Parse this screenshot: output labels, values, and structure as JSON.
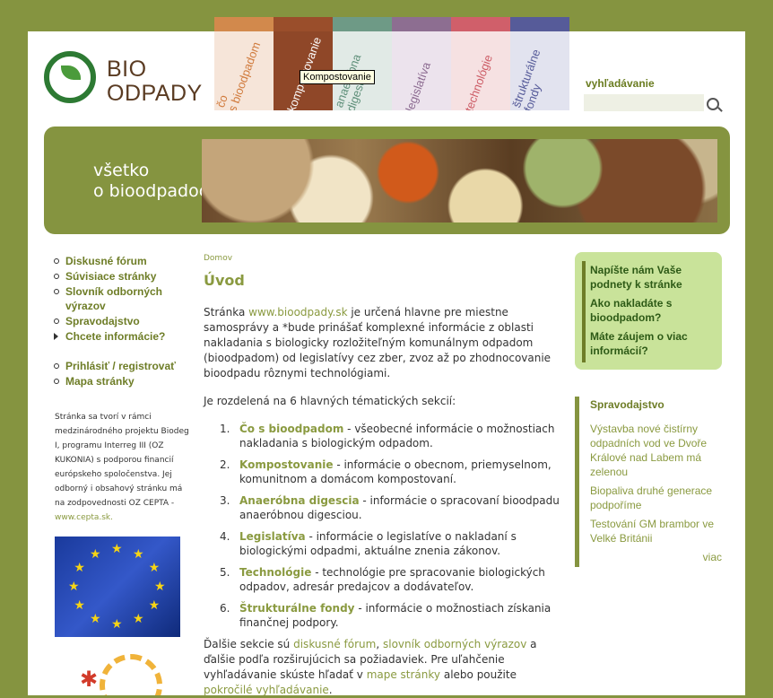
{
  "logo": {
    "line1": "BIO",
    "line2": "ODPADY"
  },
  "tabs": [
    {
      "label1": "čo",
      "label2": "s bioodpadom",
      "bar": "#d2894c",
      "bg": "#f6e5d9",
      "color": "#d07a3c"
    },
    {
      "label1": "kompostovanie",
      "label2": "",
      "bar": "#9a4e2b",
      "bg": "#8f4728",
      "color": "#ffffff"
    },
    {
      "label1": "anaeróbna",
      "label2": "digescia",
      "bar": "#6e9a86",
      "bg": "#e1eae6",
      "color": "#5e8f79"
    },
    {
      "label1": "legislatíva",
      "label2": "",
      "bar": "#8d6e91",
      "bg": "#ece3ed",
      "color": "#8b6a90"
    },
    {
      "label1": "technológie",
      "label2": "",
      "bar": "#d05f6a",
      "bg": "#f6e1e2",
      "color": "#cc5a64"
    },
    {
      "label1": "štrukturálne",
      "label2": "fondy",
      "bar": "#565b99",
      "bg": "#e2e3ef",
      "color": "#565b99"
    }
  ],
  "tooltip": "Kompostovanie",
  "search": {
    "label": "vyhľadávanie",
    "placeholder": ""
  },
  "banner": {
    "line1": "všetko",
    "line2": "o bioodpadoch"
  },
  "leftnav": {
    "group1": [
      "Diskusné fórum",
      "Súvisiace stránky",
      "Slovník odborných výrazov",
      "Spravodajstvo",
      "Chcete informácie?"
    ],
    "group2": [
      "Prihlásiť / registrovať",
      "Mapa stránky"
    ]
  },
  "sidenote": {
    "text": "Stránka sa tvorí v rámci medzinárodného projektu Biodeg I, programu Interreg III (OZ KUKONIA) s podporou financií európskeho spoločenstva. Jej odborný i obsahový stránku má na zodpovednosti OZ CEPTA -",
    "link": "www.cepta.sk."
  },
  "main": {
    "breadcrumb": "Domov",
    "title": "Úvod",
    "intro_pre": "Stránka ",
    "intro_link": "www.bioodpady.sk",
    "intro_post": " je určená hlavne pre miestne samosprávy a *bude prinášať komplexné informácie z oblasti nakladania s biologicky rozložiteľným komunálnym odpadom (bioodpadom) od legislatívy cez zber, zvoz až po zhodnocovanie bioodpadu rôznymi technológiami.",
    "sections_intro": "Je rozdelená na 6 hlavných tématických sekcií:",
    "items": [
      {
        "num": "1.",
        "title": "Čo s bioodpadom",
        "text": " - všeobecné informácie o možnostiach nakladania s biologickým odpadom."
      },
      {
        "num": "2.",
        "title": "Kompostovanie",
        "text": " - informácie o obecnom, priemyselnom, komunitnom a domácom kompostovaní."
      },
      {
        "num": "3.",
        "title": "Anaeróbna digescia",
        "text": " - informácie o spracovaní bioodpadu anaeróbnou digesciou."
      },
      {
        "num": "4.",
        "title": "Legislatíva",
        "text": " - informácie o legislatíve o nakladaní s biologickými odpadmi, aktuálne znenia zákonov."
      },
      {
        "num": "5.",
        "title": "Technológie",
        "text": " - technológie pre spracovanie biologických odpadov, adresár predajcov a dodávateľov."
      },
      {
        "num": "6.",
        "title": "Štrukturálne fondy",
        "text": " - informácie o možnostiach získania finančnej podpory."
      }
    ],
    "footer_p1": "Ďalšie sekcie sú ",
    "footer_l1": "diskusné fórum",
    "footer_p2": ", ",
    "footer_l2": "slovník odborných výrazov",
    "footer_p3": " a ďalšie podľa rozširujúcich sa požiadaviek. Pre uľahčenie vyhľadávanie skúste hľadať v ",
    "footer_l3": "mape stránky",
    "footer_p4": " alebo použite ",
    "footer_l4": "pokročilé vyhľadávanie",
    "footer_p5": "."
  },
  "rightbox": [
    "Napíšte nám Vaše podnety k stránke",
    "Ako nakladáte s bioodpadom?",
    "Máte záujem o viac informácií?"
  ],
  "news": {
    "heading": "Spravodajstvo",
    "items": [
      "Výstavba nové čistírny odpadních vod ve Dvoře Králové nad Labem má zelenou",
      "Biopaliva druhé generace podpoříme",
      "Testování GM brambor ve Velké Británii"
    ],
    "more": "viac"
  }
}
